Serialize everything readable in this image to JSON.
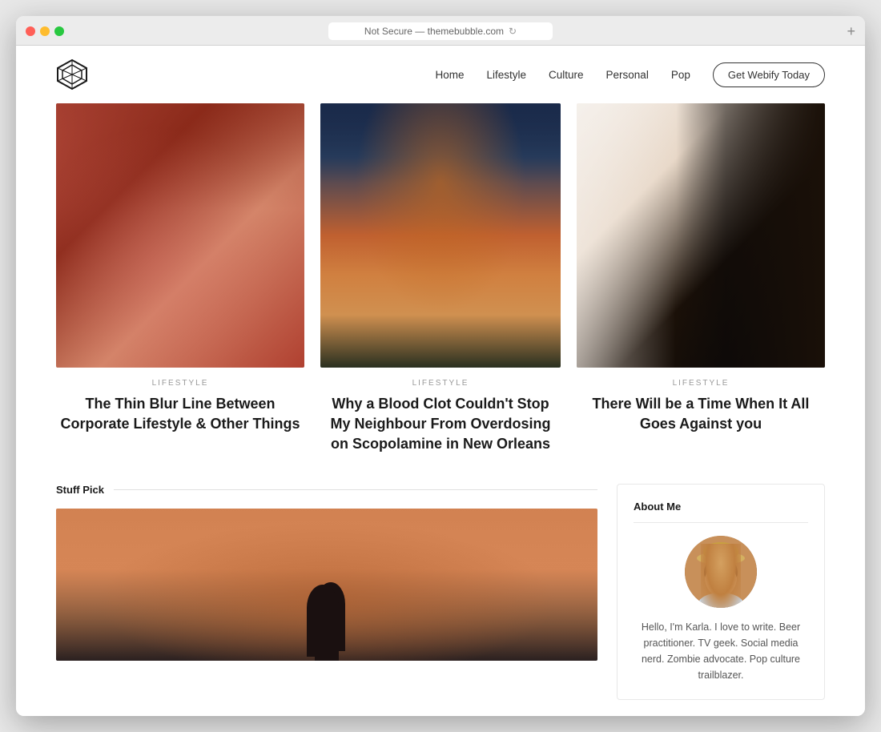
{
  "browser": {
    "address": "Not Secure — themebubble.com",
    "reload_icon": "↻",
    "new_tab": "+"
  },
  "nav": {
    "logo_label": "Logo",
    "links": [
      "Home",
      "Lifestyle",
      "Culture",
      "Personal",
      "Pop"
    ],
    "cta": "Get Webify Today"
  },
  "featured": [
    {
      "category": "LIFESTYLE",
      "title": "The Thin Blur Line Between Corporate Lifestyle & Other Things",
      "img_type": "lips"
    },
    {
      "category": "LIFESTYLE",
      "title": "Why a Blood Clot Couldn't Stop My Neighbour From Overdosing on Scopolamine in New Orleans",
      "img_type": "clifftown"
    },
    {
      "category": "LIFESTYLE",
      "title": "There Will be a Time When It All Goes Against you",
      "img_type": "couple"
    }
  ],
  "stuff_pick": {
    "section_title": "Stuff Pick"
  },
  "about": {
    "title": "About Me",
    "bio": "Hello, I'm Karla. I love to write. Beer practitioner. TV geek. Social media nerd. Zombie advocate. Pop culture trailblazer."
  }
}
